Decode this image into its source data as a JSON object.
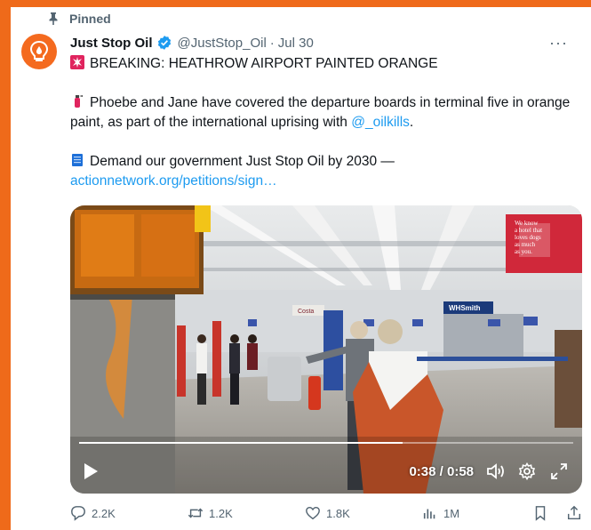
{
  "pinned": {
    "label": "Pinned",
    "icon": "pin-icon"
  },
  "author": {
    "name": "Just Stop Oil",
    "handle": "@JustStop_Oil",
    "separator": "·",
    "date": "Jul 30",
    "verified_icon": "verified-badge-icon",
    "avatar_icon": "lightbulb-drop-logo-icon",
    "avatar_color": "#f46a1f"
  },
  "more_label": "···",
  "tweet": {
    "line1_emoji": "siren-icon",
    "line1": "BREAKING: HEATHROW AIRPORT PAINTED ORANGE",
    "line2_emoji": "fire-extinguisher-icon",
    "line2": "Phoebe and Jane have covered the departure boards in terminal five in orange paint, as part of the international uprising with ",
    "line2_link": "@_oilkills",
    "line2_end": ".",
    "line3_emoji": "memo-icon",
    "line3": "Demand our government Just Stop Oil by 2030 — ",
    "line3_link": "actionnetwork.org/petitions/sign…"
  },
  "video": {
    "time": "0:38 / 0:58",
    "progress": 0.655,
    "scene_sign_text": [
      "We know",
      "a hotel that",
      "loves dogs",
      "as much",
      "as you."
    ],
    "scene_store_sign": "WHSmith",
    "scene_cafe_sign": "Costa"
  },
  "actions": {
    "replies": "2.2K",
    "retweets": "1.2K",
    "likes": "1.8K",
    "views": "1M"
  },
  "colors": {
    "border": "#ef6a1a",
    "link": "#1d9bf0",
    "muted": "#536471",
    "verified": "#1d9bf0"
  }
}
